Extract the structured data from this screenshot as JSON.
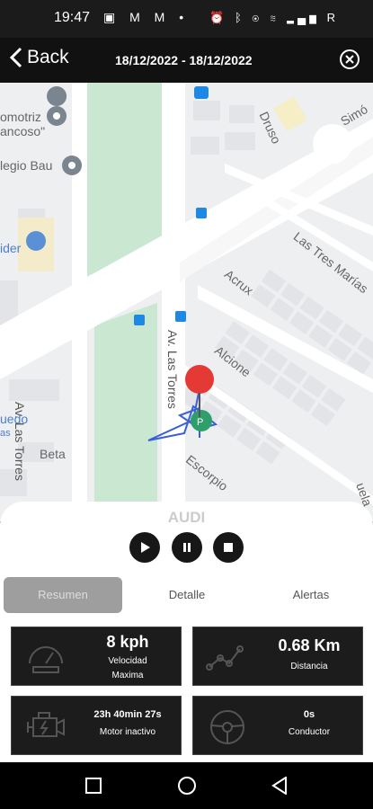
{
  "status_bar": {
    "time": "19:47",
    "left_icons": [
      "image-icon",
      "gmail-icon",
      "gmail-icon",
      "dot-icon"
    ],
    "left_icons_text": "▣ M M •",
    "right_icons": [
      "alarm-icon",
      "bluetooth-icon",
      "eye-icon",
      "wifi-icon",
      "signal-icon"
    ],
    "right_icons_text": "⏰ ᛒ ◉ ≋ ▂▄▆ R"
  },
  "header": {
    "back_label": "Back",
    "date_range": "18/12/2022 - 18/12/2022"
  },
  "map": {
    "labels": {
      "automotriz": "omotriz",
      "francoso": "ancoso\"",
      "colegio": "legio Bau",
      "rider": "ider",
      "simon": "Simó",
      "druso": "Druso",
      "tres_marias": "Las Tres Marías",
      "acrux": "Acrux",
      "av_torres_left": "Av. Las Torres",
      "av_torres_right": "Av. Las Torres",
      "alcione": "Alcione",
      "escorpio": "Escorpio",
      "beta": "Beta",
      "auedo": "uedo",
      "as": "as",
      "vuela": "uela"
    },
    "colors": {
      "road": "#ffffff",
      "park": "#c9e7d1",
      "block": "#e6e7eb",
      "bg": "#eeeff1",
      "route": "#3a5fd8",
      "pin": "#e53935"
    }
  },
  "panel": {
    "vehicle_name": "AUDI",
    "controls": {
      "play": "play-icon",
      "pause": "pause-icon",
      "stop": "stop-icon"
    },
    "tabs": [
      {
        "label": "Resumen",
        "active": true
      },
      {
        "label": "Detalle",
        "active": false
      },
      {
        "label": "Alertas",
        "active": false
      }
    ],
    "stats": {
      "speed": {
        "value": "8 kph",
        "label1": "Velocidad",
        "label2": "Maxima"
      },
      "distance": {
        "value": "0.68 Km",
        "label": "Distancia"
      },
      "idle": {
        "value": "23h 40min 27s",
        "label": "Motor inactivo"
      },
      "driver": {
        "value": "0s",
        "label": "Conductor"
      }
    }
  },
  "nav_bar": {
    "buttons": [
      "recents-icon",
      "home-icon",
      "back-icon"
    ]
  }
}
